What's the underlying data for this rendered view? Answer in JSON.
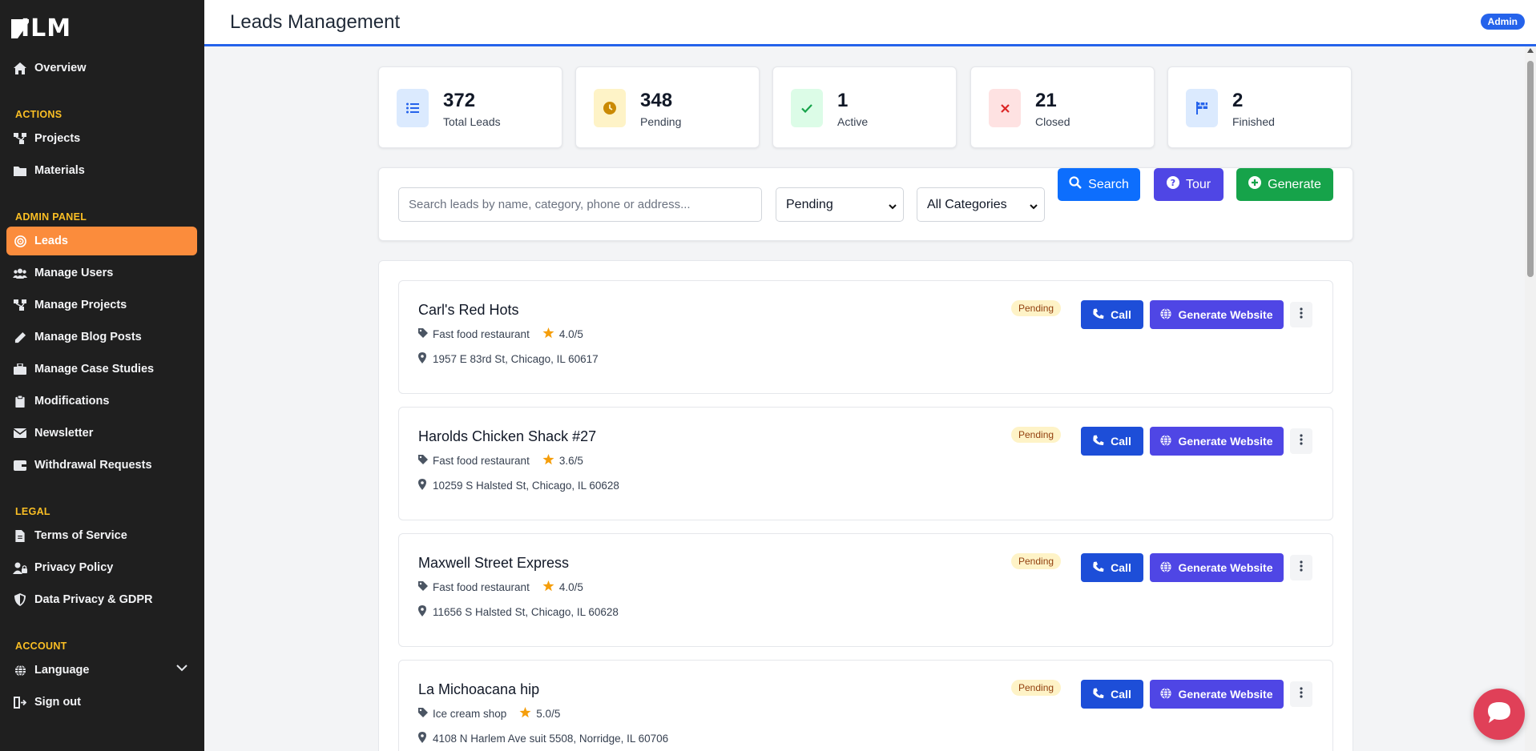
{
  "sidebar": {
    "logo": "ILM",
    "overview": "Overview",
    "sections": {
      "actions": "ACTIONS",
      "admin_panel": "ADMIN PANEL",
      "legal": "LEGAL",
      "account": "ACCOUNT"
    },
    "actions_items": [
      {
        "label": "Projects",
        "icon": "projects-icon"
      },
      {
        "label": "Materials",
        "icon": "folder-icon"
      }
    ],
    "admin_items": [
      {
        "label": "Leads",
        "icon": "target-icon",
        "active": true
      },
      {
        "label": "Manage Users",
        "icon": "users-icon"
      },
      {
        "label": "Manage Projects",
        "icon": "projects-icon"
      },
      {
        "label": "Manage Blog Posts",
        "icon": "pencil-icon"
      },
      {
        "label": "Manage Case Studies",
        "icon": "briefcase-icon"
      },
      {
        "label": "Modifications",
        "icon": "clipboard-icon"
      },
      {
        "label": "Newsletter",
        "icon": "envelope-icon"
      },
      {
        "label": "Withdrawal Requests",
        "icon": "wallet-icon"
      }
    ],
    "legal_items": [
      {
        "label": "Terms of Service",
        "icon": "document-icon"
      },
      {
        "label": "Privacy Policy",
        "icon": "user-lock-icon"
      },
      {
        "label": "Data Privacy & GDPR",
        "icon": "shield-icon"
      }
    ],
    "account_items": [
      {
        "label": "Language",
        "icon": "globe-icon"
      },
      {
        "label": "Sign out",
        "icon": "sign-out-icon"
      }
    ]
  },
  "header": {
    "title": "Leads Management",
    "role_badge": "Admin"
  },
  "stats": [
    {
      "value": "372",
      "label": "Total Leads",
      "icon": "list-icon",
      "color": "#2563eb",
      "bg": "#dbeafe"
    },
    {
      "value": "348",
      "label": "Pending",
      "icon": "clock-icon",
      "color": "#ca8a04",
      "bg": "#fef3c7"
    },
    {
      "value": "1",
      "label": "Active",
      "icon": "check-icon",
      "color": "#16a34a",
      "bg": "#dcfce7"
    },
    {
      "value": "21",
      "label": "Closed",
      "icon": "x-icon",
      "color": "#dc2626",
      "bg": "#fee2e2"
    },
    {
      "value": "2",
      "label": "Finished",
      "icon": "flag-icon",
      "color": "#2563eb",
      "bg": "#dbeafe"
    }
  ],
  "filters": {
    "search_placeholder": "Search leads by name, category, phone or address...",
    "status_selected": "Pending",
    "category_selected": "All Categories",
    "search_label": "Search",
    "tour_label": "Tour",
    "generate_label": "Generate"
  },
  "leads": [
    {
      "name": "Carl's Red Hots",
      "category": "Fast food restaurant",
      "rating": "4.0/5",
      "address": "1957 E 83rd St, Chicago, IL 60617",
      "status": "Pending"
    },
    {
      "name": "Harolds Chicken Shack #27",
      "category": "Fast food restaurant",
      "rating": "3.6/5",
      "address": "10259 S Halsted St, Chicago, IL 60628",
      "status": "Pending"
    },
    {
      "name": "Maxwell Street Express",
      "category": "Fast food restaurant",
      "rating": "4.0/5",
      "address": "11656 S Halsted St, Chicago, IL 60628",
      "status": "Pending"
    },
    {
      "name": "La Michoacana hip",
      "category": "Ice cream shop",
      "rating": "5.0/5",
      "address": "4108 N Harlem Ave suit 5508, Norridge, IL 60706",
      "status": "Pending"
    }
  ],
  "lead_actions": {
    "call_label": "Call",
    "generate_website_label": "Generate Website"
  },
  "colors": {
    "accent": "#2563eb",
    "active_nav": "#fb8c3c",
    "sidebar_bg": "#1f1f1f",
    "section_label": "#fbbf24",
    "call": "#1d4ed8",
    "generate_website": "#4f46e5",
    "tour": "#4f46e5",
    "generate": "#16a34a",
    "chat": "#e04058"
  }
}
